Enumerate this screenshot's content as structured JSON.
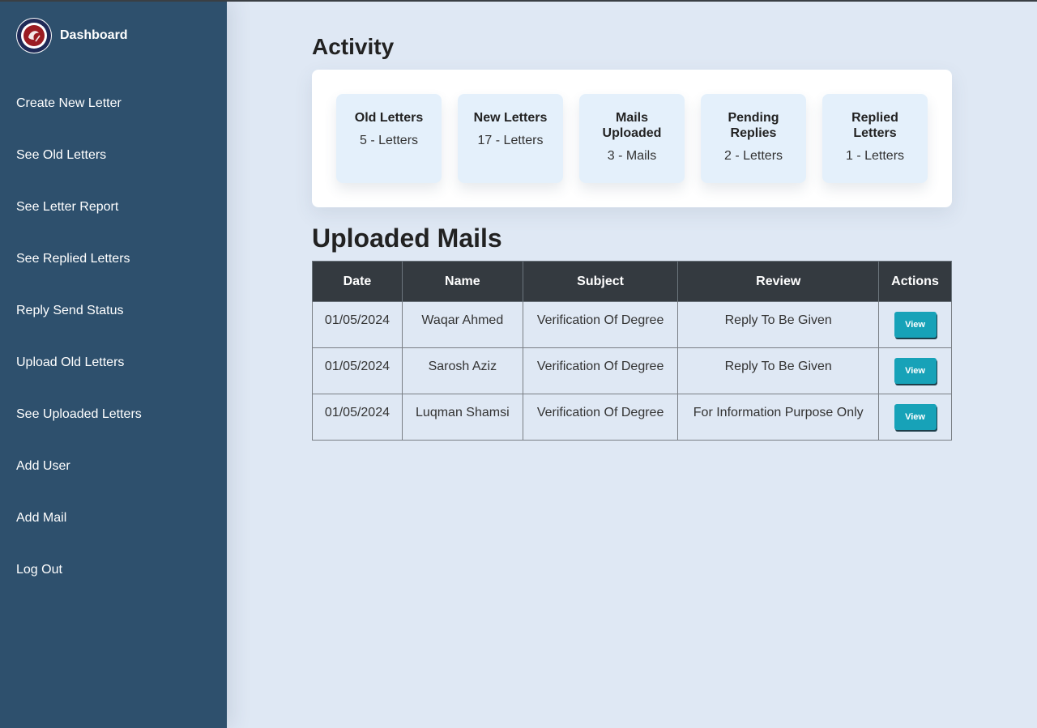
{
  "sidebar": {
    "title": "Dashboard",
    "logo_icon": "university-seal-icon",
    "items": [
      {
        "label": "Create New Letter"
      },
      {
        "label": "See Old Letters"
      },
      {
        "label": "See Letter Report"
      },
      {
        "label": "See Replied Letters"
      },
      {
        "label": "Reply Send Status"
      },
      {
        "label": "Upload Old Letters"
      },
      {
        "label": "See Uploaded Letters"
      },
      {
        "label": "Add User"
      },
      {
        "label": "Add Mail"
      },
      {
        "label": "Log Out"
      }
    ]
  },
  "activity": {
    "heading": "Activity",
    "cards": [
      {
        "title": "Old Letters",
        "value": "5 - Letters"
      },
      {
        "title": "New Letters",
        "value": "17 - Letters"
      },
      {
        "title": "Mails Uploaded",
        "value": "3 - Mails"
      },
      {
        "title": "Pending Replies",
        "value": "2 - Letters"
      },
      {
        "title": "Replied Letters",
        "value": "1 - Letters"
      }
    ]
  },
  "uploaded_mails": {
    "heading": "Uploaded Mails",
    "columns": [
      "Date",
      "Name",
      "Subject",
      "Review",
      "Actions"
    ],
    "action_label": "View",
    "rows": [
      {
        "date": "01/05/2024",
        "name": "Waqar Ahmed",
        "subject": "Verification Of Degree",
        "review": "Reply To Be Given"
      },
      {
        "date": "01/05/2024",
        "name": "Sarosh Aziz",
        "subject": "Verification Of Degree",
        "review": "Reply To Be Given"
      },
      {
        "date": "01/05/2024",
        "name": "Luqman Shamsi",
        "subject": "Verification Of Degree",
        "review": "For Information Purpose Only"
      }
    ]
  },
  "colors": {
    "sidebar_bg": "#2e506d",
    "page_bg": "#dfe8f4",
    "card_bg": "#e4f0fb",
    "table_header_bg": "#343a40",
    "view_button": "#17a2b8"
  }
}
